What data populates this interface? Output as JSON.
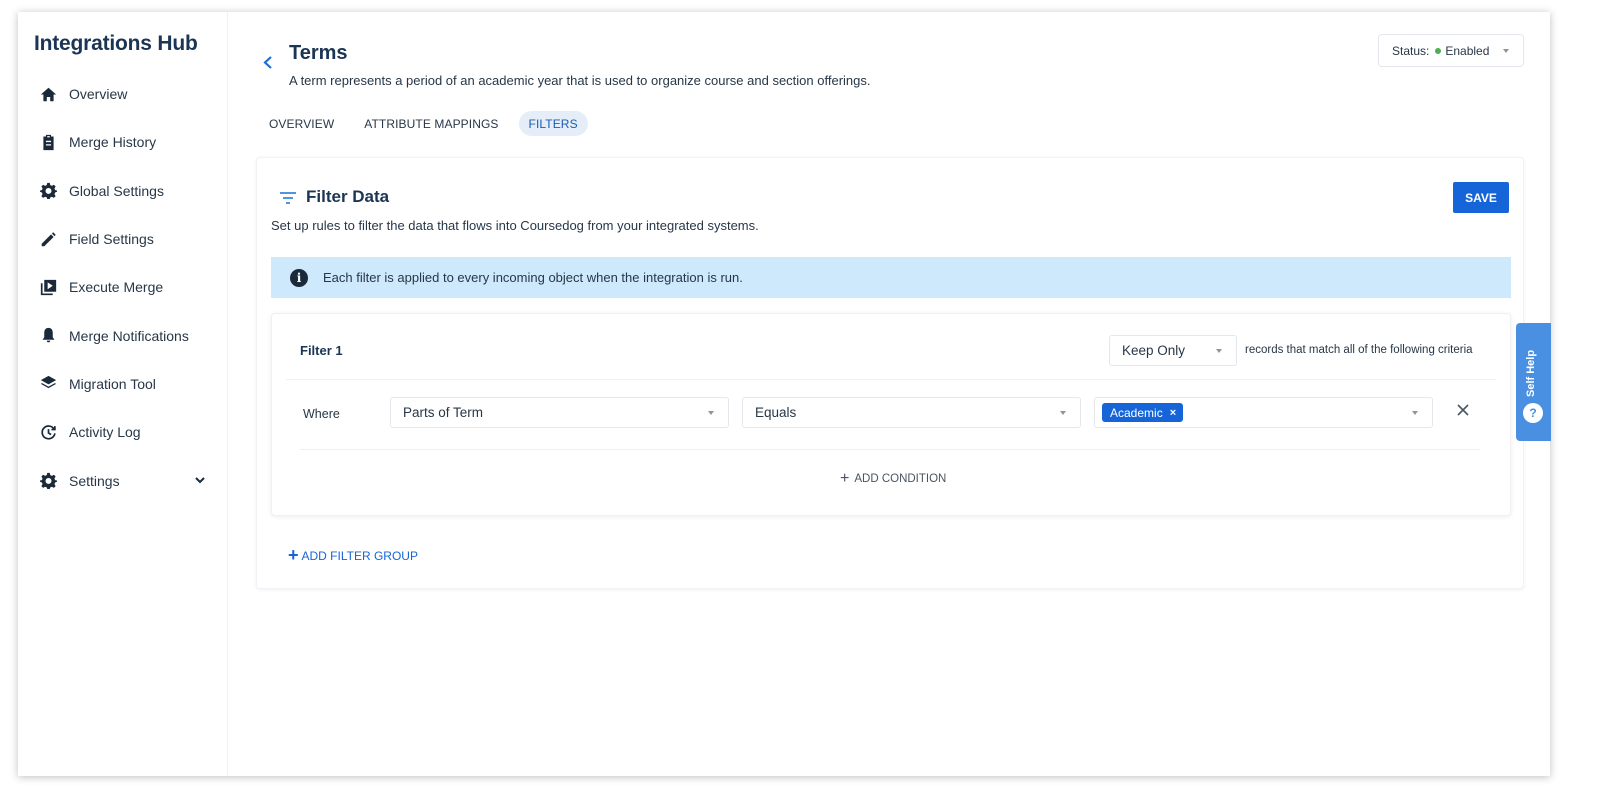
{
  "sidebar": {
    "brand": "Integrations Hub",
    "items": [
      {
        "label": "Overview",
        "icon": "home-icon"
      },
      {
        "label": "Merge History",
        "icon": "clipboard-icon"
      },
      {
        "label": "Global Settings",
        "icon": "gear-icon"
      },
      {
        "label": "Field Settings",
        "icon": "pencil-icon"
      },
      {
        "label": "Execute Merge",
        "icon": "play-library-icon"
      },
      {
        "label": "Merge Notifications",
        "icon": "bell-icon"
      },
      {
        "label": "Migration Tool",
        "icon": "layers-icon"
      },
      {
        "label": "Activity Log",
        "icon": "history-icon"
      },
      {
        "label": "Settings",
        "icon": "gear-icon"
      }
    ]
  },
  "header": {
    "title": "Terms",
    "subtitle": "A term represents a period of an academic year that is used to organize course and section offerings.",
    "status_label": "Status:",
    "status_value": "Enabled",
    "status_color": "#4caf50"
  },
  "tabs": [
    {
      "label": "OVERVIEW",
      "active": false
    },
    {
      "label": "ATTRIBUTE MAPPINGS",
      "active": false
    },
    {
      "label": "FILTERS",
      "active": true
    }
  ],
  "card": {
    "title": "Filter Data",
    "subtitle": "Set up rules to filter the data that flows into Coursedog from your integrated systems.",
    "save_label": "SAVE",
    "info": "Each filter is applied to every incoming object when the integration is run."
  },
  "filter": {
    "name": "Filter 1",
    "mode": "Keep Only",
    "records_text": "records that match all of the following criteria",
    "where_label": "Where",
    "field": "Parts of Term",
    "operator": "Equals",
    "value_chip": "Academic",
    "chip_remove": "×",
    "add_condition": "ADD CONDITION"
  },
  "add_filter_group": "ADD FILTER GROUP",
  "self_help": "Self Help",
  "colors": {
    "accent": "#1565d8",
    "info_bg": "#cde9fb",
    "brand_text": "#1b3554"
  }
}
